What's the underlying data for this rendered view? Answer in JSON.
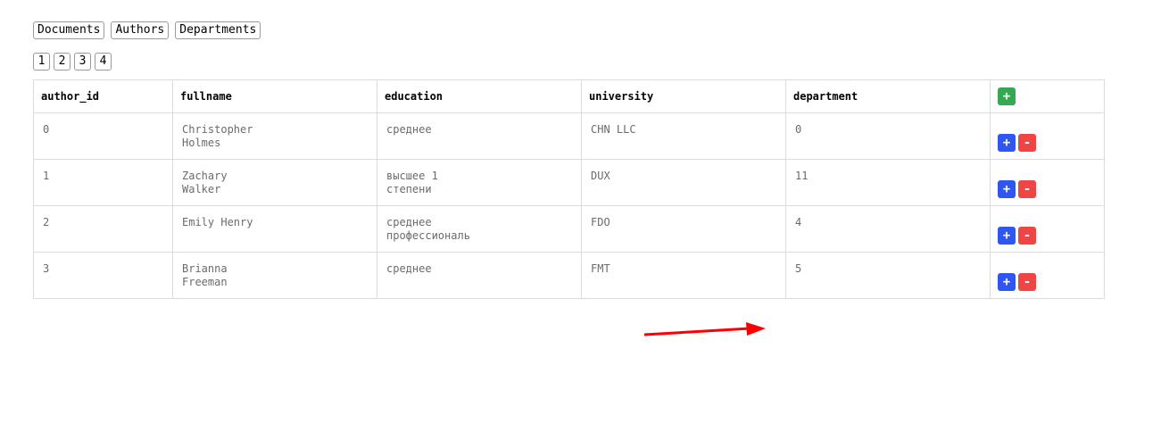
{
  "nav": {
    "items": [
      "Documents",
      "Authors",
      "Departments"
    ]
  },
  "pager": {
    "pages": [
      "1",
      "2",
      "3",
      "4"
    ]
  },
  "table": {
    "headers": [
      "author_id",
      "fullname",
      "education",
      "university",
      "department"
    ],
    "header_add_label": "+",
    "row_add_label": "+",
    "row_delete_label": "-",
    "rows": [
      [
        "0",
        "Christopher\nHolmes",
        "среднее",
        "CHN LLC",
        "0"
      ],
      [
        "1",
        "Zachary\nWalker",
        "высшее 1\nстепени",
        "DUX",
        "11"
      ],
      [
        "2",
        "Emily Henry",
        "среднее\nпрофессиональ",
        "FDO",
        "4"
      ],
      [
        "3",
        "Brianna\nFreeman",
        "среднее",
        "FMT",
        "5"
      ]
    ]
  },
  "colors": {
    "add_header": "#35a853",
    "add_row": "#2f56f0",
    "delete_row": "#f04545",
    "annotation_arrow": "#ff0000"
  },
  "icons": {
    "annotation": "red-arrow-icon"
  }
}
